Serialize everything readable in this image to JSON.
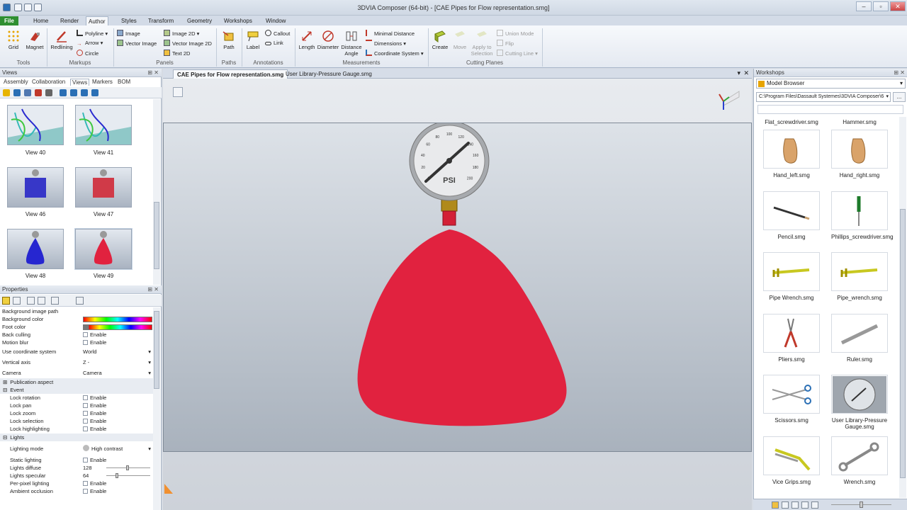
{
  "window": {
    "title": "3DVIA Composer (64-bit) - [CAE Pipes for Flow representation.smg]"
  },
  "ribbon": {
    "tabs": [
      {
        "label": "File"
      },
      {
        "label": "Home"
      },
      {
        "label": "Render"
      },
      {
        "label": "Author"
      },
      {
        "label": "Styles"
      },
      {
        "label": "Transform"
      },
      {
        "label": "Geometry"
      },
      {
        "label": "Workshops"
      },
      {
        "label": "Window"
      }
    ],
    "groups": {
      "tools": {
        "label": "Tools",
        "grid": "Grid",
        "magnet": "Magnet"
      },
      "markups": {
        "label": "Markups",
        "redlining": "Redlining",
        "polyline": "Polyline",
        "arrow": "Arrow",
        "circle": "Circle"
      },
      "panels": {
        "label": "Panels",
        "image": "Image",
        "vector_image": "Vector Image",
        "image2d": "Image 2D",
        "vector_image2d": "Vector Image 2D",
        "text2d": "Text 2D"
      },
      "paths": {
        "label": "Paths",
        "path": "Path"
      },
      "annotations": {
        "label": "Annotations",
        "label_btn": "Label",
        "callout": "Callout",
        "link": "Link"
      },
      "measurements": {
        "label": "Measurements",
        "length": "Length",
        "diameter": "Diameter",
        "distance": "Distance",
        "angle": "Angle",
        "minimal_distance": "Minimal Distance",
        "dimensions": "Dimensions",
        "coordinate_system": "Coordinate System"
      },
      "cutting": {
        "label": "Cutting Planes",
        "create": "Create",
        "move": "Move",
        "apply1": "Apply to",
        "apply2": "Selection",
        "union": "Union Mode",
        "flip": "Flip",
        "cutting_line": "Cutting Line"
      }
    }
  },
  "views_panel": {
    "title": "Views",
    "subtabs": [
      "Assembly",
      "Collaboration",
      "Views",
      "Markers",
      "BOM"
    ],
    "thumbs": [
      {
        "label": "View 40",
        "color": "#36b9b8"
      },
      {
        "label": "View 41",
        "color": "#36b9b8"
      },
      {
        "label": "View 46",
        "color": "#3737c8"
      },
      {
        "label": "View 47",
        "color": "#d03a48"
      },
      {
        "label": "View 48",
        "color": "#2626d0"
      },
      {
        "label": "View 49",
        "color": "#e1223f"
      }
    ]
  },
  "properties": {
    "title": "Properties",
    "rows": [
      {
        "k": "Background image path",
        "v": ""
      },
      {
        "k": "Background color",
        "v": ""
      },
      {
        "k": "Foot color",
        "v": ""
      },
      {
        "k": "Back culling",
        "v": "Enable"
      },
      {
        "k": "Motion blur",
        "v": "Enable"
      },
      {
        "k": "Use coordinate system",
        "v": "World"
      },
      {
        "k": "Vertical axis",
        "v": "Z -"
      },
      {
        "k": "Camera",
        "v": "Camera"
      }
    ],
    "sect_publication": "Publication aspect",
    "sect_event": "Event",
    "event_rows": [
      {
        "k": "Lock rotation",
        "v": "Enable"
      },
      {
        "k": "Lock pan",
        "v": "Enable"
      },
      {
        "k": "Lock zoom",
        "v": "Enable"
      },
      {
        "k": "Lock selection",
        "v": "Enable"
      },
      {
        "k": "Lock highlighting",
        "v": "Enable"
      }
    ],
    "sect_lights": "Lights",
    "light_rows": [
      {
        "k": "Lighting mode",
        "v": "High contrast"
      },
      {
        "k": "Static lighting",
        "v": "Enable"
      },
      {
        "k": "Lights diffuse",
        "v": "128"
      },
      {
        "k": "Lights specular",
        "v": "64"
      },
      {
        "k": "Per-pixel lighting",
        "v": "Enable"
      },
      {
        "k": "Ambient occlusion",
        "v": "Enable"
      }
    ]
  },
  "document": {
    "tabs": [
      {
        "label": "CAE Pipes for Flow representation.smg"
      },
      {
        "label": "User Library-Pressure Gauge.smg"
      }
    ],
    "gauge": {
      "unit": "PSI",
      "ticks": [
        "0",
        "20",
        "40",
        "60",
        "80",
        "100",
        "120",
        "140",
        "160",
        "180",
        "200"
      ]
    },
    "balloon_color": "#e1223f"
  },
  "workshops": {
    "title": "Workshops",
    "dropdown": "Model Browser",
    "path": "C:\\Program Files\\Dassault Systemes\\3DVIA Composer\\6",
    "top_labels": [
      "Flat_screwdriver.smg",
      "Hammer.smg"
    ],
    "items": [
      {
        "label": "Hand_left.smg",
        "icon": "hand-icon"
      },
      {
        "label": "Hand_right.smg",
        "icon": "hand-icon"
      },
      {
        "label": "Pencil.smg",
        "icon": "pencil-icon"
      },
      {
        "label": "Phillips_screwdriver.smg",
        "icon": "screwdriver-icon"
      },
      {
        "label": "Pipe Wrench.smg",
        "icon": "pipe-wrench-icon"
      },
      {
        "label": "Pipe_wrench.smg",
        "icon": "pipe-wrench-icon"
      },
      {
        "label": "Pliers.smg",
        "icon": "pliers-icon"
      },
      {
        "label": "Ruler.smg",
        "icon": "ruler-icon"
      },
      {
        "label": "Scissors.smg",
        "icon": "scissors-icon"
      },
      {
        "label": "User Library-Pressure Gauge.smg",
        "icon": "gauge-icon"
      },
      {
        "label": "Vice Grips.smg",
        "icon": "vice-grips-icon"
      },
      {
        "label": "Wrench.smg",
        "icon": "wrench-icon"
      }
    ]
  }
}
